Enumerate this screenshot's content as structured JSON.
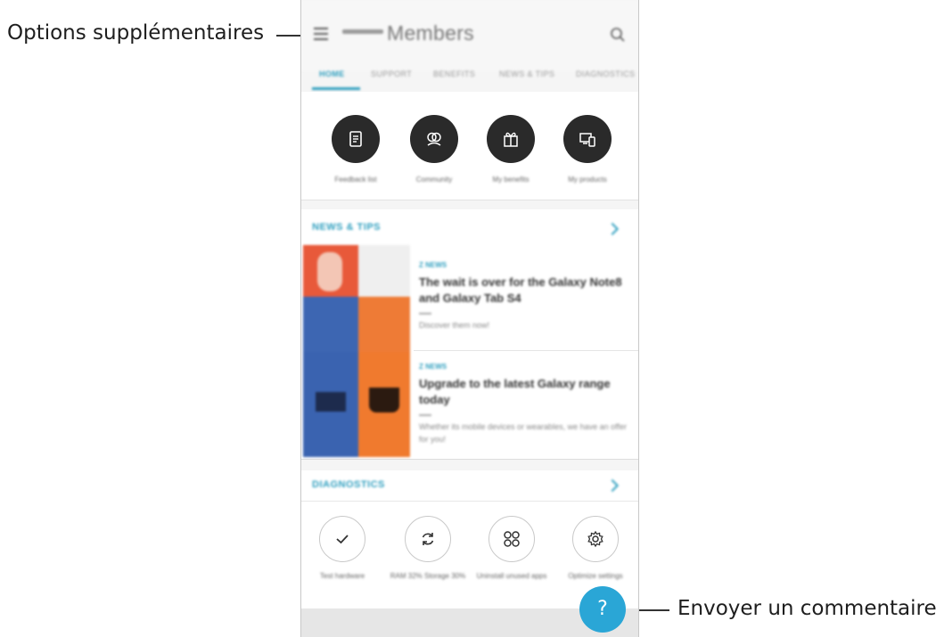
{
  "annotations": {
    "menu_label": "Options supplémentaires",
    "feedback_label": "Envoyer un commentaire."
  },
  "appbar": {
    "title": "Members",
    "menu_icon": "hamburger-menu-icon",
    "search_icon": "search-icon"
  },
  "tabs": [
    "HOME",
    "SUPPORT",
    "BENEFITS",
    "NEWS & TIPS",
    "DIAGNOSTICS"
  ],
  "quick_actions": [
    {
      "label": "Feedback list",
      "icon": "document-icon"
    },
    {
      "label": "Community",
      "icon": "community-icon"
    },
    {
      "label": "My benefits",
      "icon": "gift-icon"
    },
    {
      "label": "My products",
      "icon": "devices-icon"
    }
  ],
  "news": {
    "title": "NEWS & TIPS",
    "articles": [
      {
        "tag": "Z NEWS",
        "title": "The wait is over for the Galaxy Note8 and Galaxy Tab S4",
        "desc": "Discover them now!"
      },
      {
        "tag": "Z NEWS",
        "title": "Upgrade to the latest Galaxy range today",
        "desc": "Whether its mobile devices or wearables, we have an offer for you!"
      }
    ]
  },
  "diagnostics": {
    "title": "DIAGNOSTICS",
    "items": [
      {
        "label": "Test hardware",
        "icon": "check-icon"
      },
      {
        "label": "RAM 32% Storage 30%",
        "icon": "refresh-icon"
      },
      {
        "label": "Uninstall unused apps",
        "icon": "apps-grid-icon"
      },
      {
        "label": "Optimize settings",
        "icon": "gear-icon"
      }
    ]
  },
  "fab": {
    "symbol": "?",
    "icon": "help-icon"
  },
  "colors": {
    "accent": "#2f9fbf",
    "fab": "#2aa6d6",
    "dark_circle": "#2a2a2a"
  }
}
